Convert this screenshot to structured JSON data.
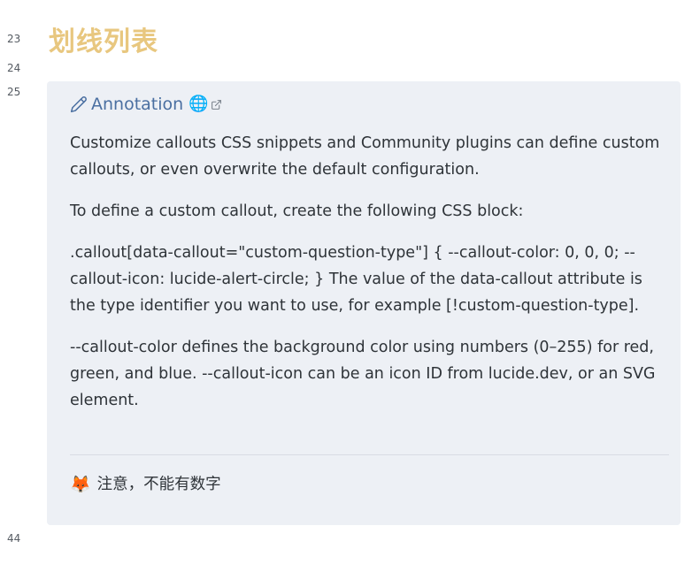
{
  "gutter": {
    "line_23": "23",
    "line_24": "24",
    "line_25": "25",
    "line_44": "44"
  },
  "heading": "划线列表",
  "callout": {
    "title": "Annotation",
    "title_icon": "pencil-icon",
    "link_icons": [
      "globe-icon",
      "external-link-icon"
    ],
    "paragraphs": [
      "Customize callouts CSS snippets and Community plugins can define custom callouts, or even overwrite the default configuration.",
      "To define a custom callout, create the following CSS block:",
      ".callout[data-callout=\"custom-question-type\"] { --callout-color: 0, 0, 0; --callout-icon: lucide-alert-circle; } The value of the data-callout attribute is the type identifier you want to use, for example [!custom-question-type].",
      "--callout-color defines the background color using numbers (0–255) for red, green, and blue. --callout-icon can be an icon ID from lucide.dev, or an SVG element."
    ],
    "note_emoji": "🦊",
    "note_text": "注意，不能有数字"
  },
  "colors": {
    "heading": "#e8c77f",
    "callout_bg": "#edf0f5",
    "title": "#4a6fa1"
  }
}
